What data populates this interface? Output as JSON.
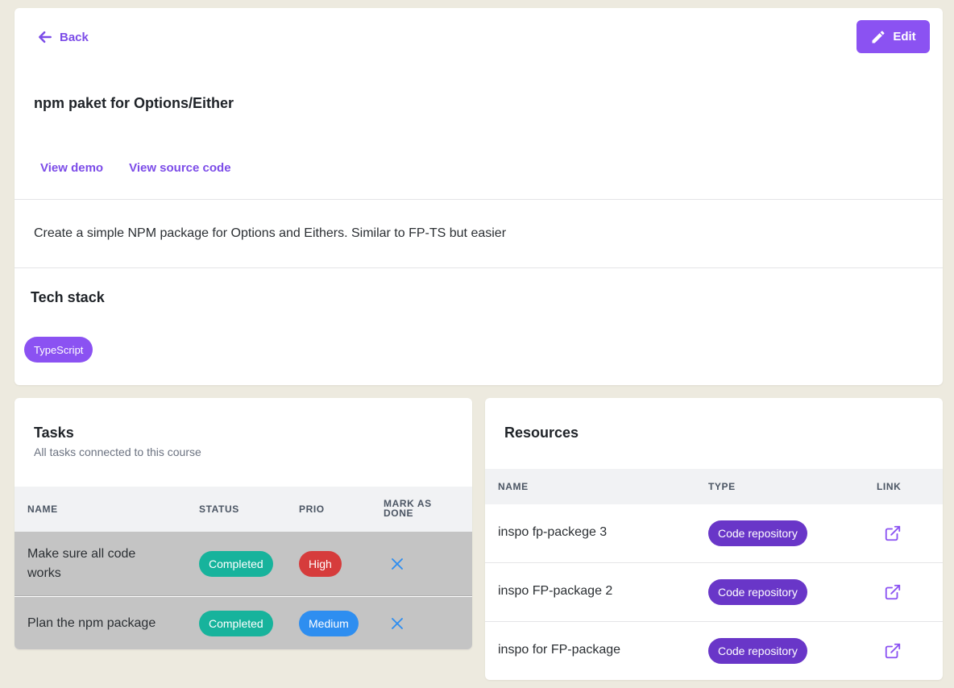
{
  "header": {
    "back_label": "Back",
    "edit_label": "Edit",
    "title": "npm paket for Options/Either",
    "links": [
      "View demo",
      "View source code"
    ],
    "description": "Create a simple NPM package for Options and Eithers. Similar to FP-TS but easier"
  },
  "tech_stack": {
    "title": "Tech stack",
    "items": [
      "TypeScript"
    ]
  },
  "tasks": {
    "title": "Tasks",
    "subtitle": "All tasks connected to this course",
    "columns": [
      "NAME",
      "STATUS",
      "PRIO",
      "MARK AS DONE"
    ],
    "rows": [
      {
        "name": "Make sure all code works",
        "status": "Completed",
        "prio": "High"
      },
      {
        "name": "Plan the npm package",
        "status": "Completed",
        "prio": "Medium"
      }
    ]
  },
  "resources": {
    "title": "Resources",
    "columns": [
      "NAME",
      "TYPE",
      "LINK"
    ],
    "rows": [
      {
        "name": "inspo fp-packege 3",
        "type": "Code repository"
      },
      {
        "name": "inspo FP-package 2",
        "type": "Code repository"
      },
      {
        "name": "inspo for FP-package",
        "type": "Code repository"
      }
    ]
  },
  "colors": {
    "accent": "#8b52f2",
    "link": "#7c4ce8",
    "status_completed": "#17b39c",
    "prio_high": "#d63c3c",
    "prio_medium": "#2e8ef0",
    "resource_type": "#6936c8",
    "background": "#edeadf"
  },
  "icons": {
    "back": "arrow-left-icon",
    "edit": "pencil-icon",
    "mark_done": "close-icon",
    "link": "external-link-icon"
  }
}
